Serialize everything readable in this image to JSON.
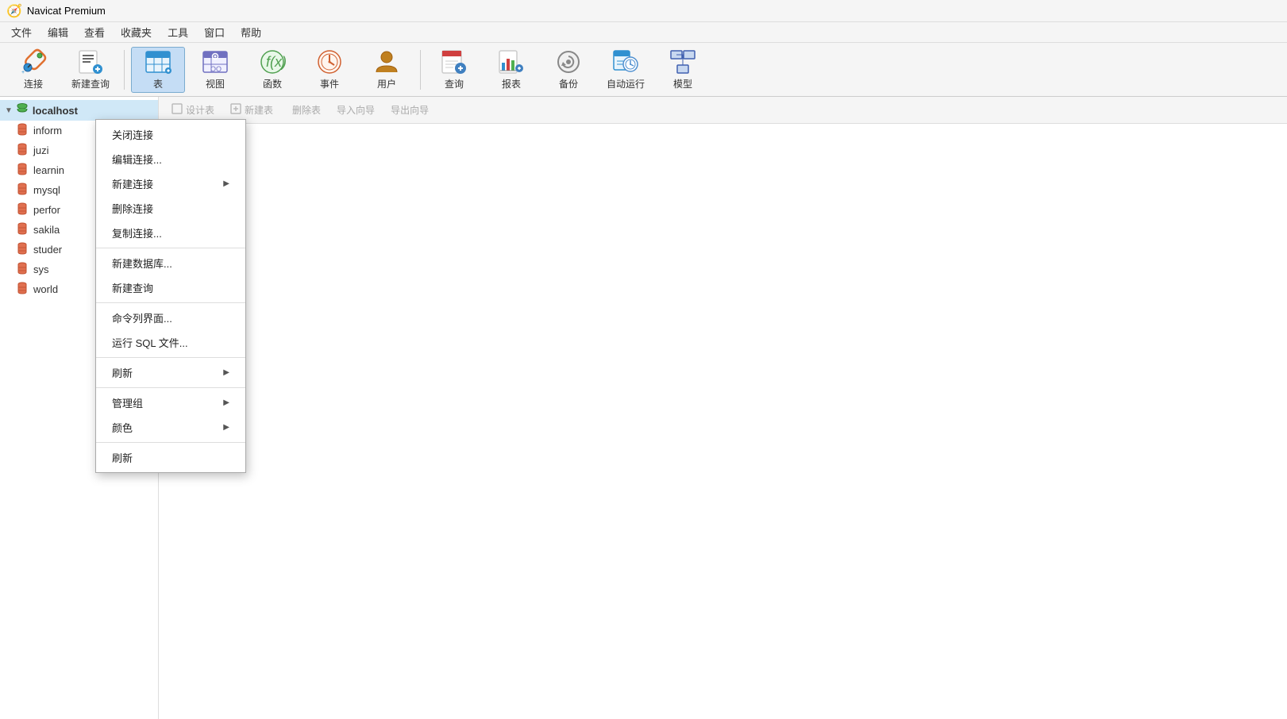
{
  "titleBar": {
    "icon": "🧭",
    "title": "Navicat Premium"
  },
  "menuBar": {
    "items": [
      "文件",
      "编辑",
      "查看",
      "收藏夹",
      "工具",
      "窗口",
      "帮助"
    ]
  },
  "toolbar": {
    "buttons": [
      {
        "id": "connect",
        "label": "连接",
        "icon": "🔧"
      },
      {
        "id": "new-query",
        "label": "新建查询",
        "icon": "📋"
      },
      {
        "id": "table",
        "label": "表",
        "icon": "📊",
        "active": true
      },
      {
        "id": "view",
        "label": "视图",
        "icon": "👓"
      },
      {
        "id": "function",
        "label": "函数",
        "icon": "ƒ"
      },
      {
        "id": "event",
        "label": "事件",
        "icon": "🕐"
      },
      {
        "id": "user",
        "label": "用户",
        "icon": "👤"
      },
      {
        "id": "query",
        "label": "查询",
        "icon": "📅"
      },
      {
        "id": "report",
        "label": "报表",
        "icon": "📈"
      },
      {
        "id": "backup",
        "label": "备份",
        "icon": "💾"
      },
      {
        "id": "autorun",
        "label": "自动运行",
        "icon": "⏱"
      },
      {
        "id": "model",
        "label": "模型",
        "icon": "🗂"
      }
    ]
  },
  "sidebar": {
    "connection": {
      "label": "localhost",
      "expanded": true
    },
    "databases": [
      {
        "id": "inform",
        "label": "inform"
      },
      {
        "id": "juzi",
        "label": "juzi"
      },
      {
        "id": "learning",
        "label": "learnin"
      },
      {
        "id": "mysql",
        "label": "mysql"
      },
      {
        "id": "perfor",
        "label": "perfor"
      },
      {
        "id": "sakila",
        "label": "sakila"
      },
      {
        "id": "student",
        "label": "studer"
      },
      {
        "id": "sys",
        "label": "sys"
      },
      {
        "id": "world",
        "label": "world"
      }
    ]
  },
  "contentToolbar": {
    "buttons": [
      "设计表",
      "新建表",
      "删除表",
      "导入向导",
      "导出向导"
    ]
  },
  "contextMenu": {
    "items": [
      {
        "id": "close-conn",
        "label": "关闭连接",
        "hasArrow": false
      },
      {
        "id": "edit-conn",
        "label": "编辑连接...",
        "hasArrow": false
      },
      {
        "id": "new-conn",
        "label": "新建连接",
        "hasArrow": true
      },
      {
        "id": "delete-conn",
        "label": "删除连接",
        "hasArrow": false
      },
      {
        "id": "copy-conn",
        "label": "复制连接...",
        "hasArrow": false
      },
      {
        "separator": true
      },
      {
        "id": "new-db",
        "label": "新建数据库...",
        "hasArrow": false
      },
      {
        "id": "new-query2",
        "label": "新建查询",
        "hasArrow": false
      },
      {
        "separator": true
      },
      {
        "id": "cmdline",
        "label": "命令列界面...",
        "hasArrow": false
      },
      {
        "id": "run-sql",
        "label": "运行 SQL 文件...",
        "hasArrow": false
      },
      {
        "separator": true
      },
      {
        "id": "refresh",
        "label": "刷新",
        "hasArrow": true
      },
      {
        "separator": true
      },
      {
        "id": "manage-group",
        "label": "管理组",
        "hasArrow": true
      },
      {
        "id": "color",
        "label": "颜色",
        "hasArrow": true
      },
      {
        "separator": true
      },
      {
        "id": "refresh2",
        "label": "刷新",
        "hasArrow": false
      }
    ]
  }
}
